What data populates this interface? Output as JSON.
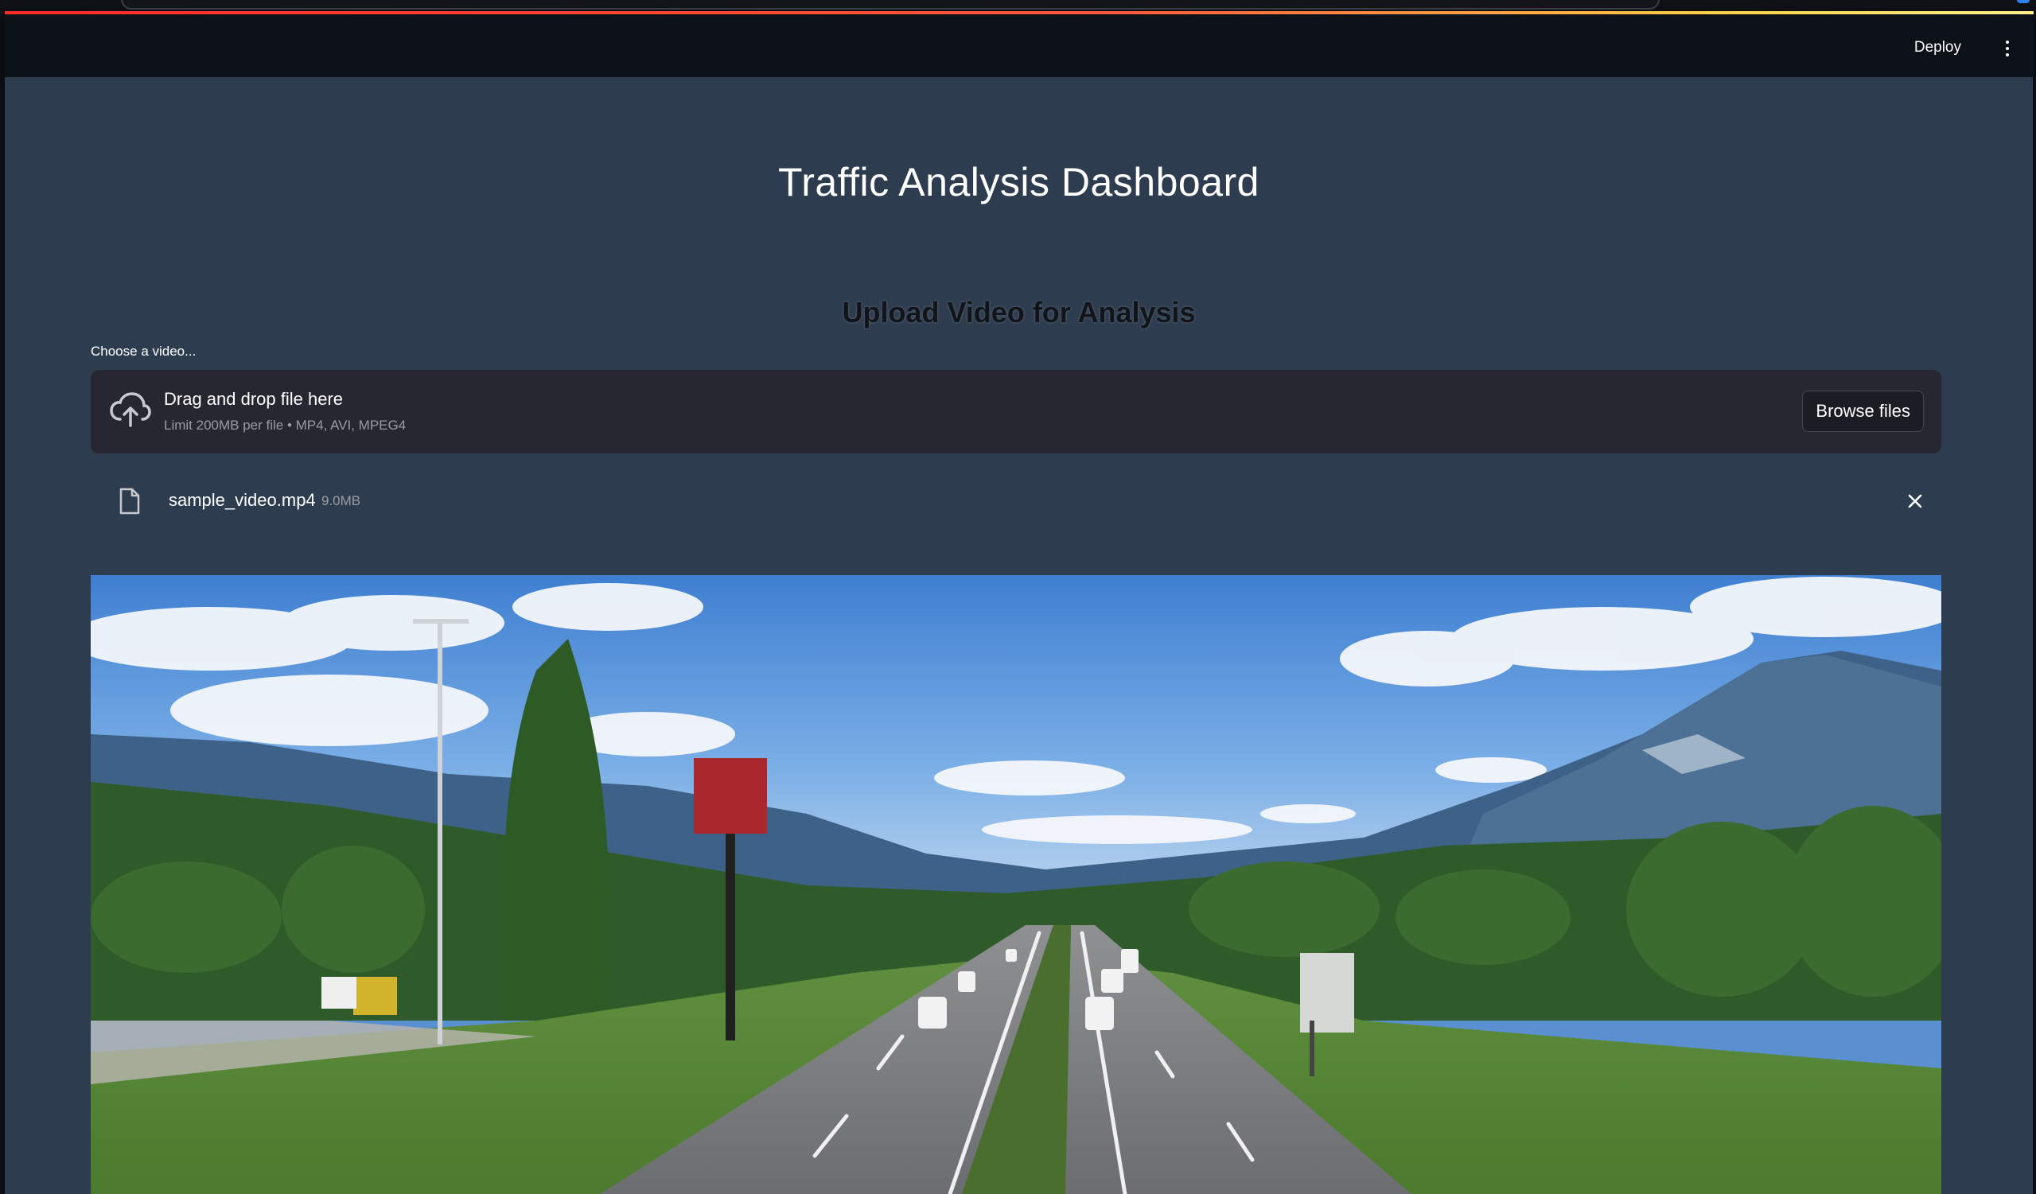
{
  "header": {
    "deploy_label": "Deploy",
    "menu_icon": "kebab-menu-icon"
  },
  "main": {
    "title": "Traffic Analysis Dashboard",
    "section_heading": "Upload Video for Analysis"
  },
  "uploader": {
    "label": "Choose a video...",
    "dropzone_title": "Drag and drop file here",
    "dropzone_hint": "Limit 200MB per file • MP4, AVI, MPEG4",
    "browse_label": "Browse files",
    "upload_icon": "cloud-upload-icon"
  },
  "uploaded_file": {
    "name": "sample_video.mp4",
    "size": "9.0MB",
    "file_icon": "file-icon",
    "remove_icon": "close-icon"
  },
  "video": {
    "description_icon": "video-frame-highway"
  },
  "colors": {
    "app_background": "#2d3d4f",
    "header_background": "#0d1118",
    "dropzone_background": "#262730",
    "accent_red": "#ff2b2b"
  }
}
